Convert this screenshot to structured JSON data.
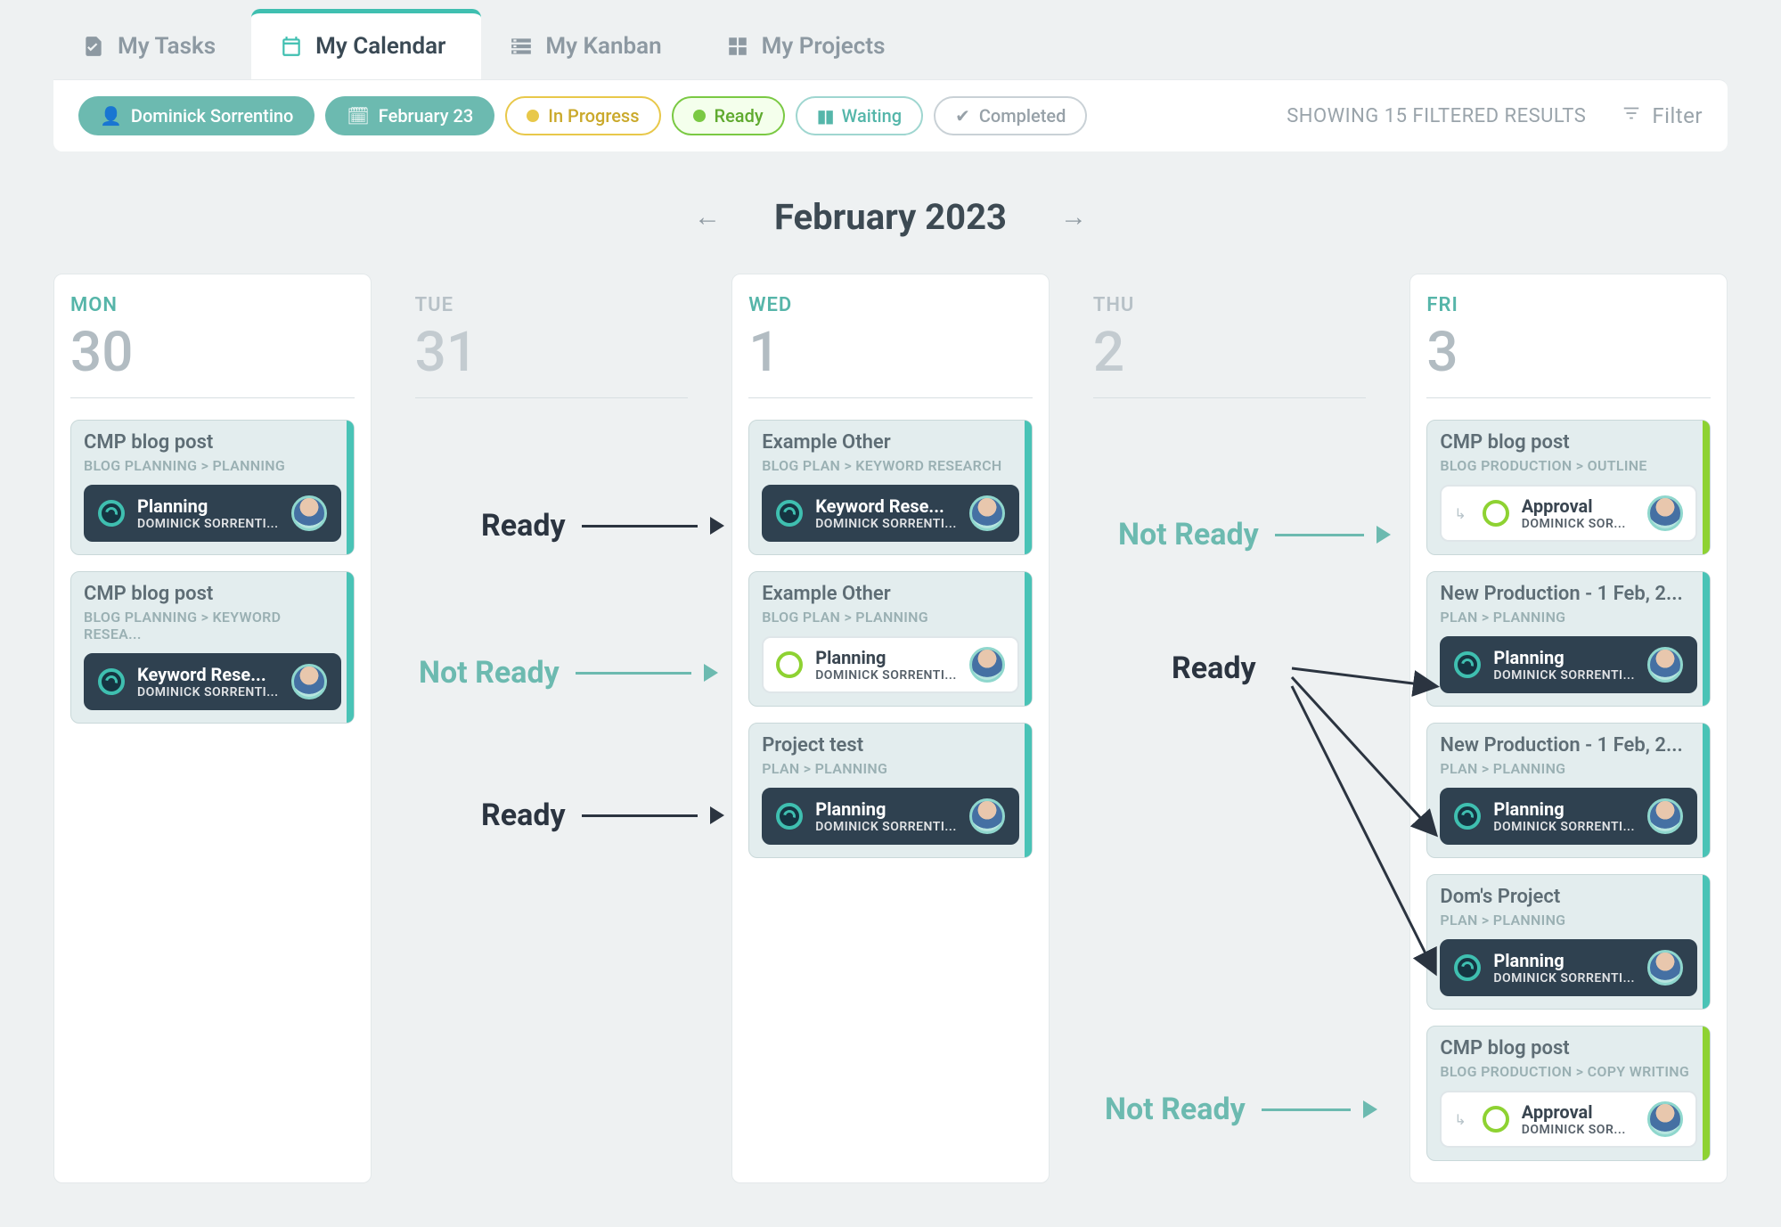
{
  "tabs": {
    "tasks": "My Tasks",
    "calendar": "My Calendar",
    "kanban": "My Kanban",
    "projects": "My Projects"
  },
  "filters": {
    "person": "Dominick Sorrentino",
    "date": "February 23",
    "inprog": "In Progress",
    "ready": "Ready",
    "waiting": "Waiting",
    "done": "Completed",
    "summary": "SHOWING 15 FILTERED RESULTS",
    "filter_label": "Filter"
  },
  "month": {
    "label": "February 2023"
  },
  "days": {
    "mon": {
      "dow": "MON",
      "num": "30"
    },
    "tue": {
      "dow": "TUE",
      "num": "31"
    },
    "wed": {
      "dow": "WED",
      "num": "1"
    },
    "thu": {
      "dow": "THU",
      "num": "2"
    },
    "fri": {
      "dow": "FRI",
      "num": "3"
    }
  },
  "cards": {
    "mon0": {
      "title": "CMP blog post",
      "crumb": "BLOG PLANNING > PLANNING",
      "task": "Planning",
      "owner": "DOMINICK SORRENTI..."
    },
    "mon1": {
      "title": "CMP blog post",
      "crumb": "BLOG PLANNING > KEYWORD RESEA...",
      "task": "Keyword Rese...",
      "owner": "DOMINICK SORRENTI..."
    },
    "wed0": {
      "title": "Example Other",
      "crumb": "BLOG PLAN > KEYWORD RESEARCH",
      "task": "Keyword Rese...",
      "owner": "DOMINICK SORRENTI..."
    },
    "wed1": {
      "title": "Example Other",
      "crumb": "BLOG PLAN > PLANNING",
      "task": "Planning",
      "owner": "DOMINICK SORRENTI..."
    },
    "wed2": {
      "title": "Project test",
      "crumb": "PLAN > PLANNING",
      "task": "Planning",
      "owner": "DOMINICK SORRENTI..."
    },
    "fri0": {
      "title": "CMP blog post",
      "crumb": "BLOG PRODUCTION > OUTLINE",
      "task": "Approval",
      "owner": "DOMINICK SOR..."
    },
    "fri1": {
      "title": "New Production - 1 Feb, 2...",
      "crumb": "PLAN > PLANNING",
      "task": "Planning",
      "owner": "DOMINICK SORRENTI..."
    },
    "fri2": {
      "title": "New Production - 1 Feb, 2...",
      "crumb": "PLAN > PLANNING",
      "task": "Planning",
      "owner": "DOMINICK SORRENTI..."
    },
    "fri3": {
      "title": "Dom's Project",
      "crumb": "PLAN > PLANNING",
      "task": "Planning",
      "owner": "DOMINICK SORRENTI..."
    },
    "fri4": {
      "title": "CMP blog post",
      "crumb": "BLOG PRODUCTION > COPY WRITING",
      "task": "Approval",
      "owner": "DOMINICK SOR..."
    }
  },
  "annotations": {
    "ready": "Ready",
    "notready": "Not Ready"
  }
}
